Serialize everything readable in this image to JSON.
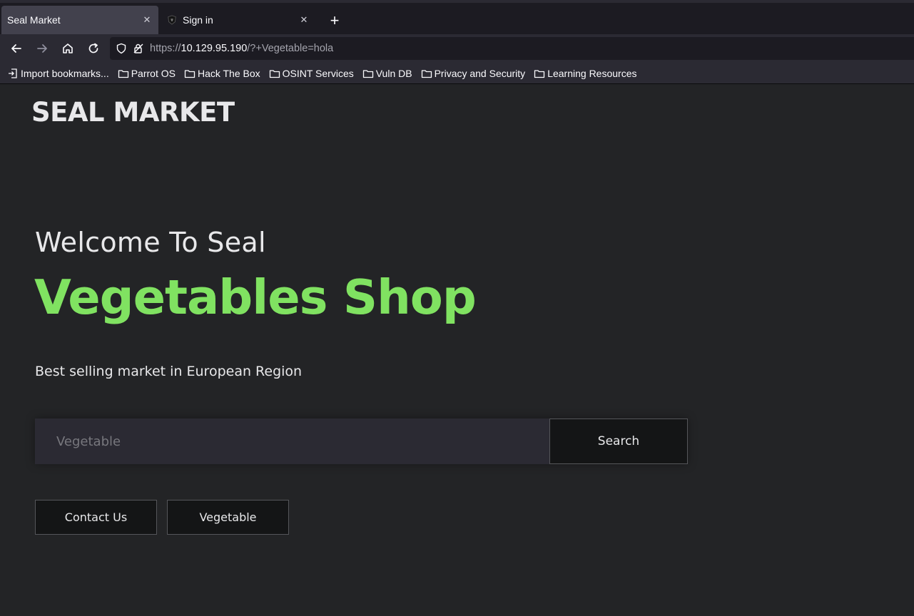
{
  "browser": {
    "tabs": [
      {
        "label": "Seal Market",
        "active": true
      },
      {
        "label": "Sign in",
        "active": false
      }
    ],
    "url": {
      "prefix": "https://",
      "host": "10.129.95.190",
      "rest": "/?+Vegetable=hola"
    },
    "bookmarks": [
      {
        "label": "Import bookmarks...",
        "icon": "import-icon"
      },
      {
        "label": "Parrot OS",
        "icon": "folder-icon"
      },
      {
        "label": "Hack The Box",
        "icon": "folder-icon"
      },
      {
        "label": "OSINT Services",
        "icon": "folder-icon"
      },
      {
        "label": "Vuln DB",
        "icon": "folder-icon"
      },
      {
        "label": "Privacy and Security",
        "icon": "folder-icon"
      },
      {
        "label": "Learning Resources",
        "icon": "folder-icon"
      }
    ]
  },
  "page": {
    "logo": "SEAL MARKET",
    "welcome": "Welcome To Seal",
    "hero": "Vegetables Shop",
    "subtitle": "Best selling market in European Region",
    "search": {
      "placeholder": "Vegetable",
      "value": "",
      "button_label": "Search"
    },
    "buttons": {
      "contact_label": "Contact Us",
      "vegetable_label": "Vegetable"
    }
  },
  "colors": {
    "background": "#232426",
    "accent_green": "#80e261",
    "text": "#e8e8ea",
    "button_bg": "#141516"
  }
}
